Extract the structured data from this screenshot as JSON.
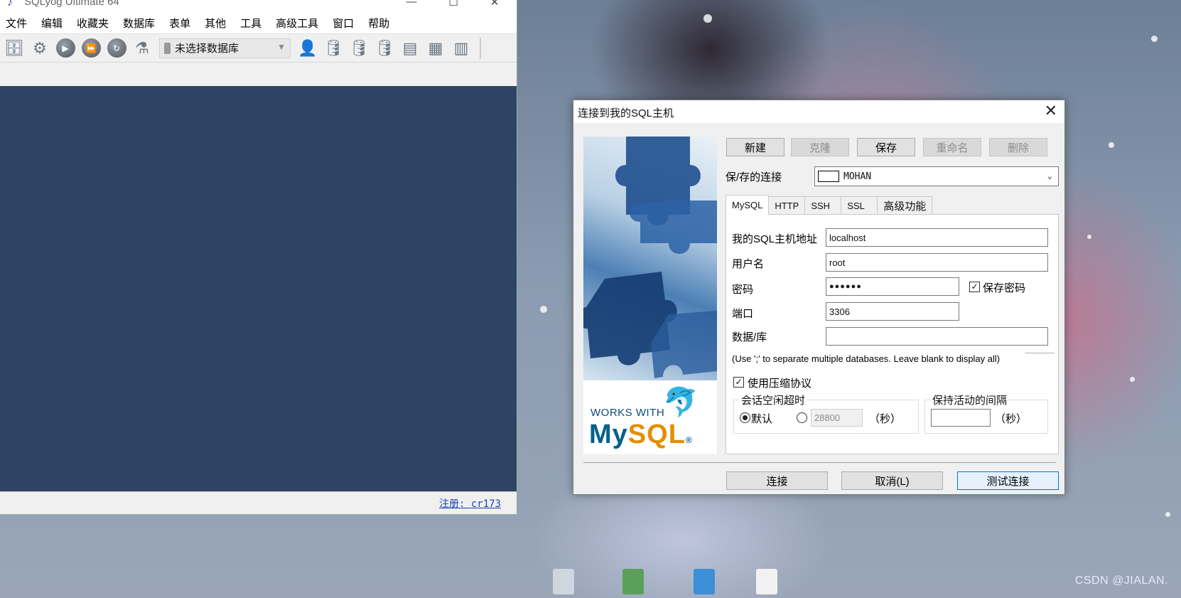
{
  "app": {
    "title": "SQLyog Ultimate 64",
    "window_controls": {
      "minimize": "—",
      "maximize": "☐",
      "close": "✕"
    },
    "menu": [
      "文件",
      "编辑",
      "收藏夹",
      "数据库",
      "表单",
      "其他",
      "工具",
      "高级工具",
      "窗口",
      "帮助"
    ],
    "database_selector": "未选择数据库",
    "status_link": "注册: cr173"
  },
  "dialog": {
    "title": "连接到我的SQL主机",
    "close": "✕",
    "buttons": {
      "new": "新建",
      "clone": "克隆",
      "save": "保存",
      "rename": "重命名",
      "delete": "删除"
    },
    "saved_connection_label": "保/存的连接",
    "saved_connection_value": "MOHAN",
    "tabs": [
      "MySQL",
      "HTTP",
      "SSH",
      "SSL",
      "高级功能"
    ],
    "active_tab": "MySQL",
    "form": {
      "host_label": "我的SQL主机地址",
      "host_value": "localhost",
      "user_label": "用户名",
      "user_value": "root",
      "password_label": "密码",
      "password_value": "●●●●●●",
      "save_password_label": "保存密码",
      "save_password_checked": true,
      "port_label": "端口",
      "port_value": "3306",
      "database_label": "数据/库",
      "database_value": "",
      "database_note": "(Use ';' to separate multiple databases. Leave blank to display all)",
      "compress_label": "使用压缩协议",
      "compress_checked": true,
      "session_timeout_title": "会话空闲超时",
      "default_label": "默认",
      "default_selected": true,
      "timeout_value": "28800",
      "seconds_unit": "（秒）",
      "keepalive_title": "保持活动的间隔",
      "keepalive_value": "",
      "keepalive_unit": "（秒）"
    },
    "footer": {
      "connect": "连接",
      "cancel": "取消(L)",
      "test": "测试连接"
    },
    "banner": {
      "works_with": "WORKS WITH",
      "brand_my": "My",
      "brand_sql": "SQL",
      "registered_mark": "®"
    }
  },
  "desktop": {
    "watermark": "CSDN @JIALAN."
  },
  "colors": {
    "workspace": "#2f4463",
    "link": "#1a3fb8",
    "mysql_blue": "#00618a",
    "mysql_orange": "#e48e00"
  }
}
